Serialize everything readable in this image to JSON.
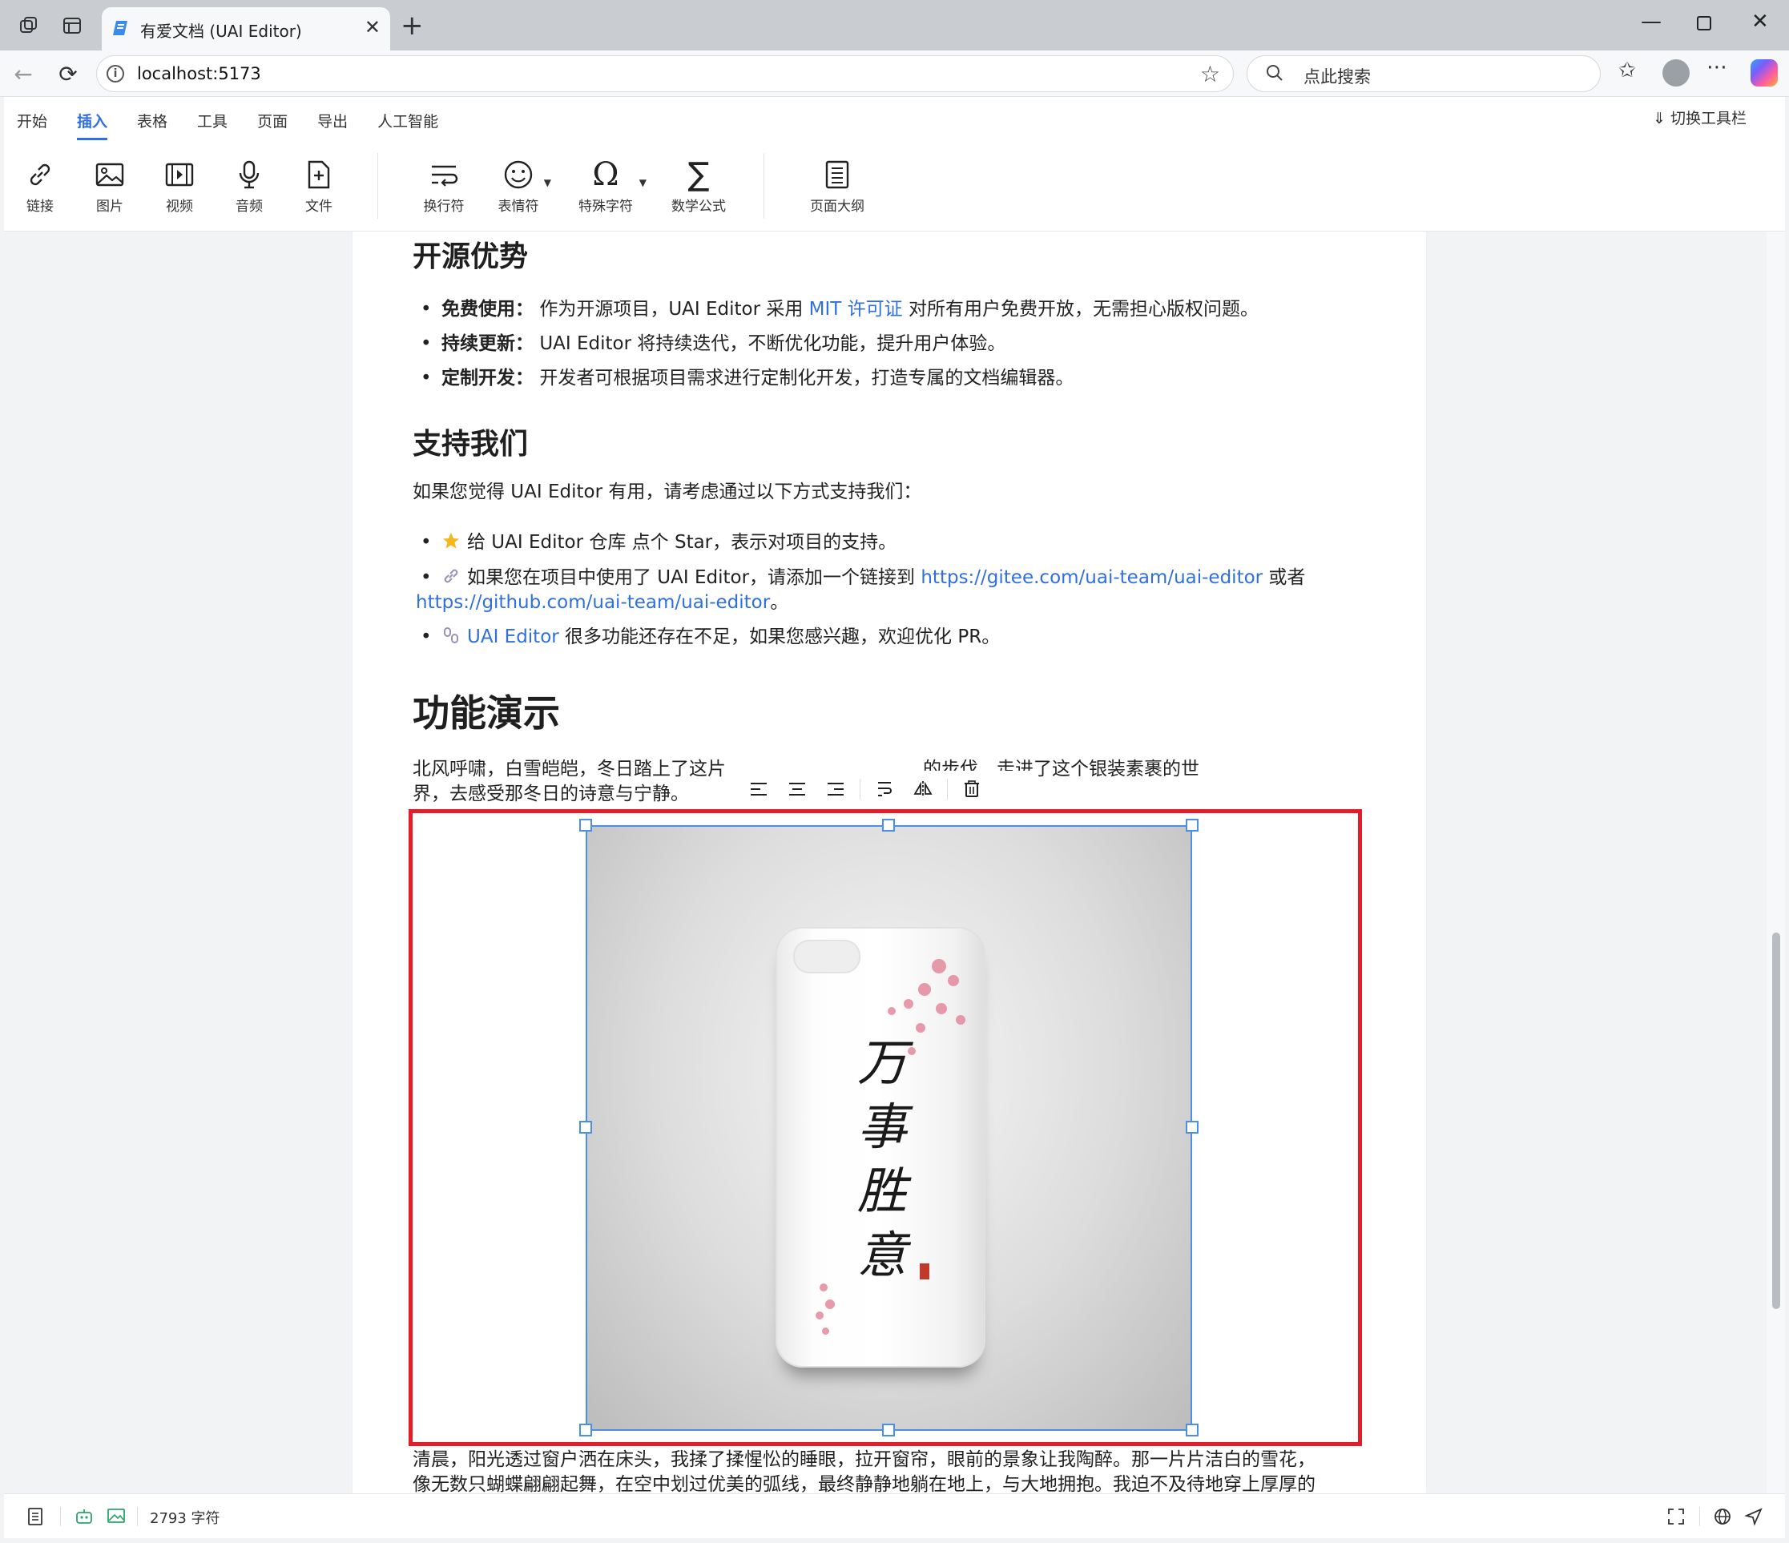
{
  "browser": {
    "tab_title": "有爱文档 (UAI Editor)",
    "url": "localhost:5173",
    "search_placeholder": "点此搜索"
  },
  "ribbon": {
    "menu": [
      "开始",
      "插入",
      "表格",
      "工具",
      "页面",
      "导出",
      "人工智能"
    ],
    "active_menu": "插入",
    "toggle_toolbar": "切换工具栏",
    "tools": {
      "link": "链接",
      "image": "图片",
      "video": "视频",
      "audio": "音频",
      "file": "文件",
      "line_break": "换行符",
      "emoji": "表情符",
      "special_char": "特殊字符",
      "math": "数学公式",
      "outline": "页面大纲"
    }
  },
  "doc": {
    "h_open_source": "开源优势",
    "os_items": [
      {
        "label": "免费使用：",
        "pre": "作为开源项目，UAI Editor 采用 ",
        "link": "MIT 许可证",
        "post": " 对所有用户免费开放，无需担心版权问题。"
      },
      {
        "label": "持续更新：",
        "text": "UAI Editor 将持续迭代，不断优化功能，提升用户体验。"
      },
      {
        "label": "定制开发：",
        "text": "开发者可根据项目需求进行定制化开发，打造专属的文档编辑器。"
      }
    ],
    "h_support": "支持我们",
    "support_intro": "如果您觉得 UAI Editor 有用，请考虑通过以下方式支持我们：",
    "support_items": [
      {
        "text": "给 UAI Editor 仓库 点个 Star，表示对项目的支持。"
      },
      {
        "pre": "如果您在项目中使用了 UAI Editor，请添加一个链接到 ",
        "link1": "https://gitee.com/uai-team/uai-editor",
        "mid": " 或者",
        "link2": "https://github.com/uai-team/uai-editor",
        "post": "。"
      },
      {
        "link": "UAI Editor",
        "post": " 很多功能还存在不足，如果您感兴趣，欢迎优化 PR。"
      }
    ],
    "h_demo": "功能演示",
    "demo_p1_line1": "北风呼啸，白雪皑皑，冬日踏上了这片",
    "demo_p1_line1_tail": "的步伐，走进了这个银装素裹的世",
    "demo_p1_line2": "界，去感受那冬日的诗意与宁静。",
    "image_calligraphy": "万事胜意",
    "demo_p2_line1": "清晨，阳光透过窗户洒在床头，我揉了揉惺忪的睡眼，拉开窗帘，眼前的景象让我陶醉。那一片片洁白的雪花，",
    "demo_p2_line2": "像无数只蝴蝶翩翩起舞，在空中划过优美的弧线，最终静静地躺在地上，与大地拥抱。我迫不及待地穿上厚厚的"
  },
  "status": {
    "char_count": "2793 字符"
  },
  "colors": {
    "accent": "#2f6fe0",
    "selection_red": "#e11d2a",
    "image_outline": "#4a8fe8"
  }
}
